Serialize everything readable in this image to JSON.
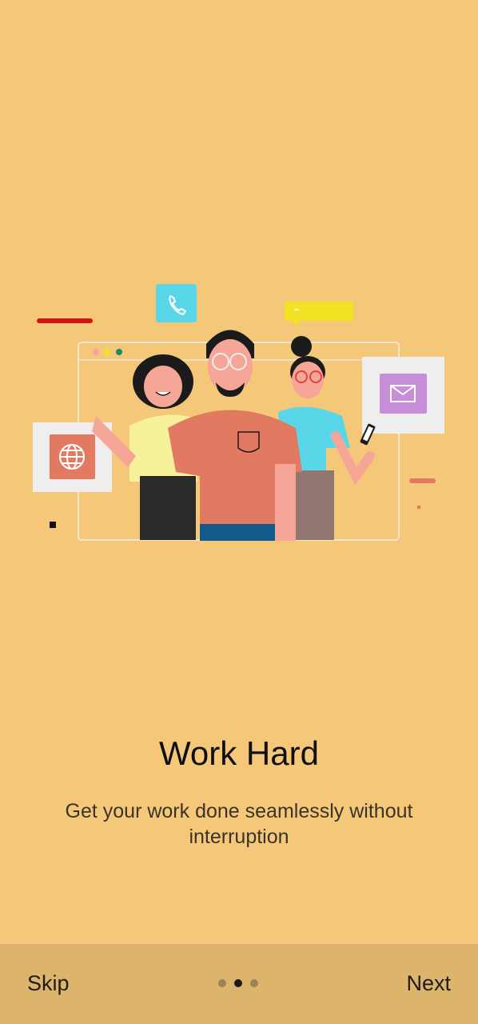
{
  "onboarding": {
    "title": "Work Hard",
    "subtitle": "Get your work done seamlessly without interruption",
    "skip_label": "Skip",
    "next_label": "Next",
    "page_indicator": {
      "total": 3,
      "active_index": 1
    }
  },
  "illustration": {
    "icons": [
      "phone-icon",
      "globe-icon",
      "mail-icon"
    ]
  },
  "colors": {
    "background": "#F4C878",
    "bottom_bar": "#DDB46C",
    "phone_tile": "#59D7E8",
    "speech_bubble": "#F2E224",
    "mail_tile": "#C88ED8",
    "globe_tile": "#E27961",
    "shirt": "#E27961"
  }
}
